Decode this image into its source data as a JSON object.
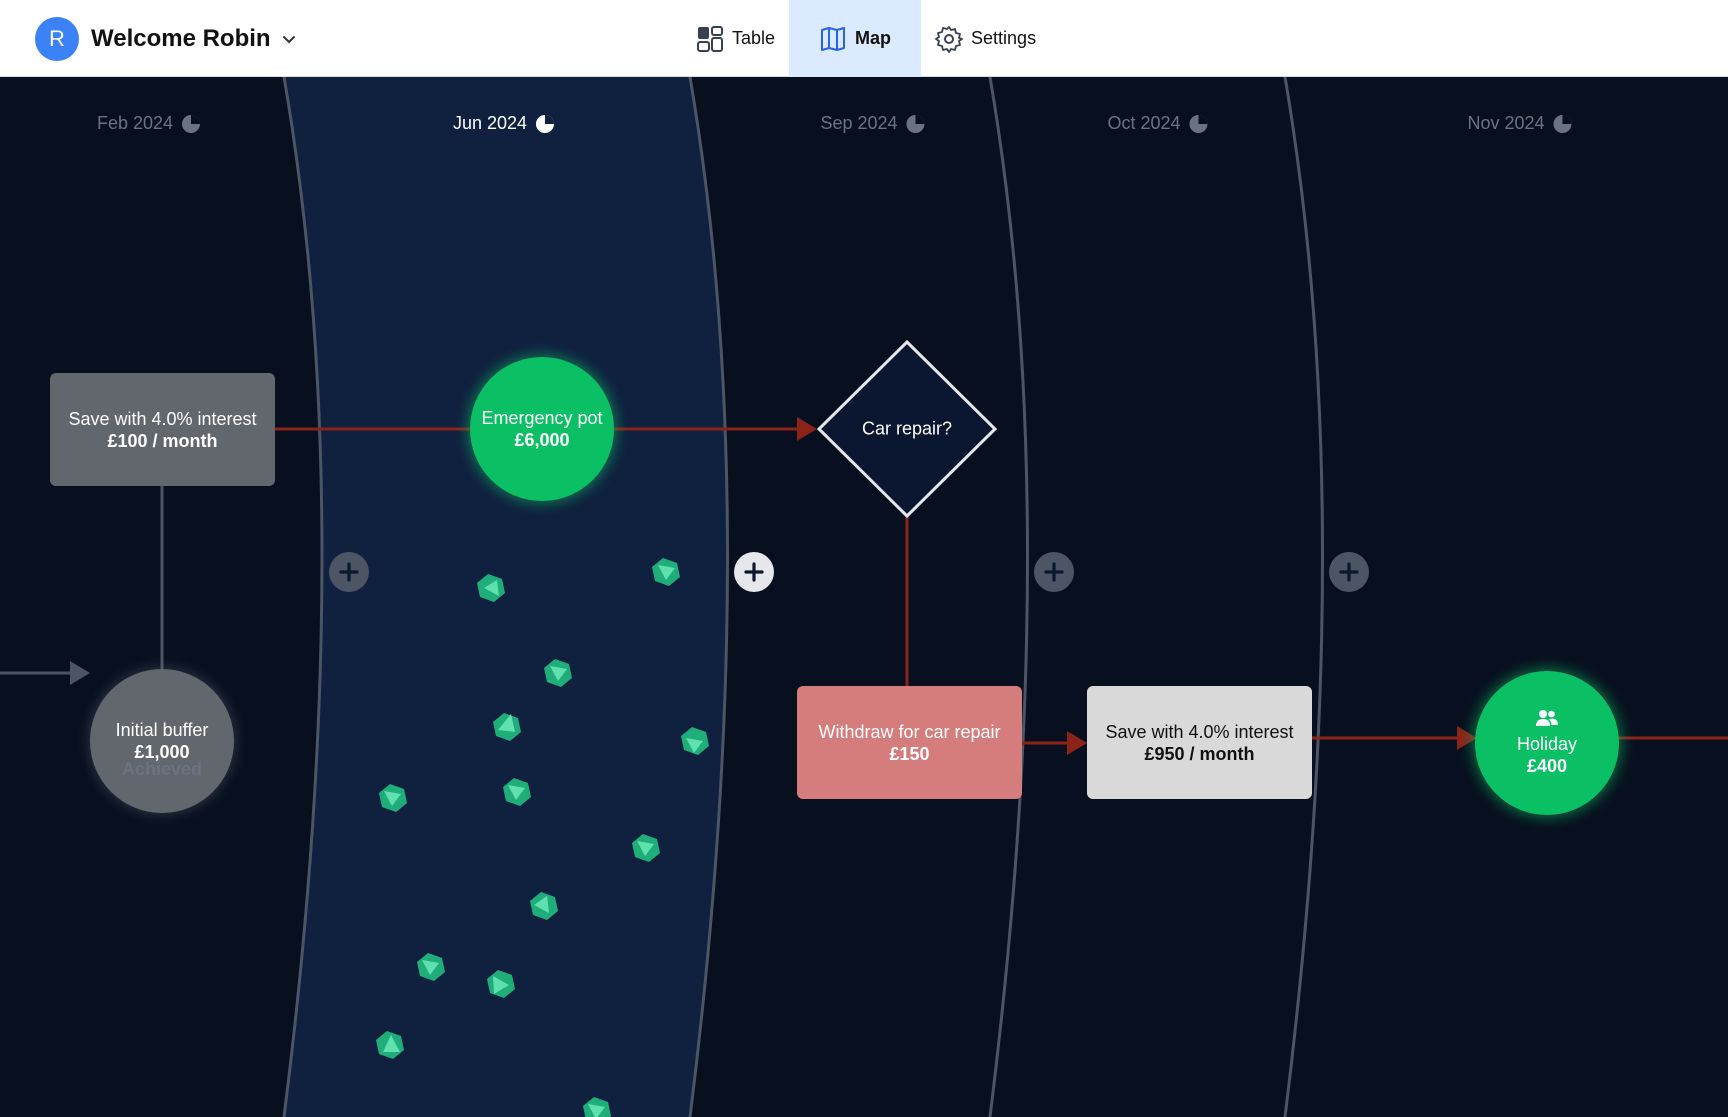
{
  "header": {
    "avatar_initial": "R",
    "welcome": "Welcome Robin",
    "tabs": [
      {
        "label": "Table",
        "icon": "table-icon"
      },
      {
        "label": "Map",
        "icon": "map-icon",
        "active": true
      },
      {
        "label": "Settings",
        "icon": "gear-icon"
      }
    ]
  },
  "timeline": {
    "months": [
      {
        "label": "Feb 2024"
      },
      {
        "label": "Jun 2024",
        "active": true
      },
      {
        "label": "Sep 2024"
      },
      {
        "label": "Oct 2024"
      },
      {
        "label": "Nov 2024"
      }
    ]
  },
  "nodes": {
    "save_top": {
      "title": "Save with 4.0% interest",
      "amount": "£100 / month"
    },
    "emergency": {
      "title": "Emergency pot",
      "amount": "£6,000"
    },
    "car_repair_decision": {
      "title": "Car repair?"
    },
    "initial_buffer": {
      "title": "Initial buffer",
      "amount": "£1,000",
      "status": "Achieved"
    },
    "withdraw": {
      "title": "Withdraw for car repair",
      "amount": "£150"
    },
    "save_bottom": {
      "title": "Save with 4.0% interest",
      "amount": "£950 / month"
    },
    "holiday": {
      "title": "Holiday",
      "amount": "£400",
      "icon": "people-icon"
    }
  },
  "colors": {
    "canvas_bg": "#08101f",
    "active_band": "#10203f",
    "flow_line": "#8b2318",
    "green_node": "#0abf64",
    "gray_node": "#62666d",
    "withdraw_node": "#d57c7c",
    "save_bottom_node": "#d9d9d9",
    "accent_blue": "#3b82f6"
  }
}
